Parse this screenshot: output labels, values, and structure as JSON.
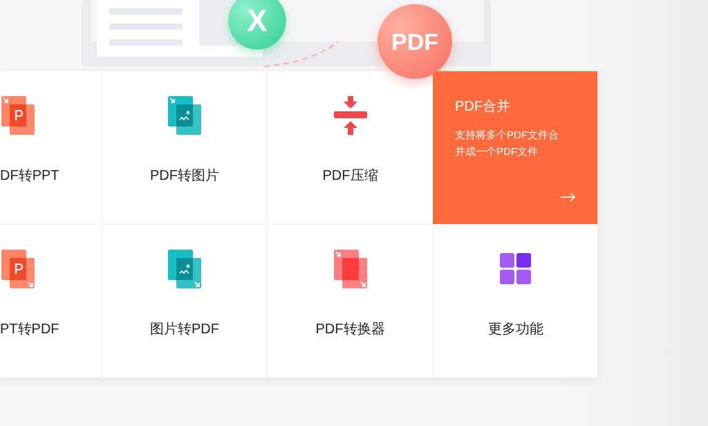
{
  "illustration": {
    "badges": [
      {
        "kind": "excel",
        "text": "X"
      },
      {
        "kind": "pdf",
        "text": "PDF"
      }
    ]
  },
  "tools": [
    {
      "label": "DF转PPT",
      "kind": "pdf-to-ppt",
      "selected": false
    },
    {
      "label": "PDF转图片",
      "kind": "pdf-to-image",
      "selected": false
    },
    {
      "label": "PDF压缩",
      "kind": "compress",
      "selected": false
    },
    {
      "label": "PDF合并",
      "selected": true,
      "description": "支持将多个PDF文件合并成一个PDF文件"
    },
    {
      "label": "PT转PDF",
      "kind": "ppt-to-pdf",
      "selected": false
    },
    {
      "label": "图片转PDF",
      "kind": "image-to-pdf",
      "selected": false
    },
    {
      "label": "PDF转换器",
      "kind": "converter",
      "selected": false
    },
    {
      "label": "更多功能",
      "kind": "more",
      "selected": false
    }
  ]
}
